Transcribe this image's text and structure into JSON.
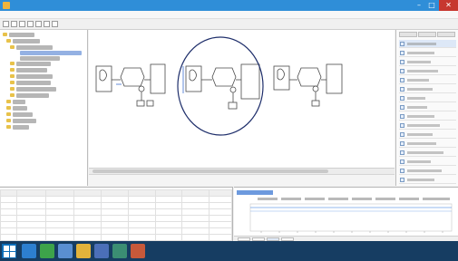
{
  "window": {
    "title": "",
    "min_glyph": "–",
    "max_glyph": "□",
    "close_glyph": "✕"
  },
  "menu": [
    "",
    "",
    "",
    "",
    "",
    ""
  ],
  "left_tree": {
    "items": [
      "",
      "",
      "",
      "",
      "",
      "",
      "",
      "",
      "",
      "",
      "",
      "",
      "",
      "",
      "",
      "",
      ""
    ]
  },
  "canvas": {
    "highlight_circle_color": "#1f2f6b",
    "node_stroke_color": "#4a4a4a",
    "accent_color": "#3d6fd1"
  },
  "right_panel": {
    "tabs": [
      "",
      "",
      ""
    ],
    "rows": [
      "",
      "",
      "",
      "",
      "",
      "",
      "",
      "",
      "",
      "",
      "",
      "",
      "",
      "",
      "",
      ""
    ]
  },
  "table": {
    "headers": [
      "",
      "",
      "",
      "",
      "",
      "",
      "",
      "",
      ""
    ],
    "rows": [
      [
        "",
        "",
        "",
        "",
        "",
        "",
        "",
        "",
        ""
      ],
      [
        "",
        "",
        "",
        "",
        "",
        "",
        "",
        "",
        ""
      ],
      [
        "",
        "",
        "",
        "",
        "",
        "",
        "",
        "",
        ""
      ],
      [
        "",
        "",
        "",
        "",
        "",
        "",
        "",
        "",
        ""
      ],
      [
        "",
        "",
        "",
        "",
        "",
        "",
        "",
        "",
        ""
      ],
      [
        "",
        "",
        "",
        "",
        "",
        "",
        "",
        "",
        ""
      ],
      [
        "",
        "",
        "",
        "",
        "",
        "",
        "",
        "",
        ""
      ]
    ]
  },
  "chart": {
    "legend": [
      "",
      "",
      "",
      "",
      "",
      "",
      "",
      ""
    ],
    "tabs": [
      "",
      "",
      "",
      ""
    ]
  },
  "taskbar": {
    "time": "",
    "date": ""
  }
}
